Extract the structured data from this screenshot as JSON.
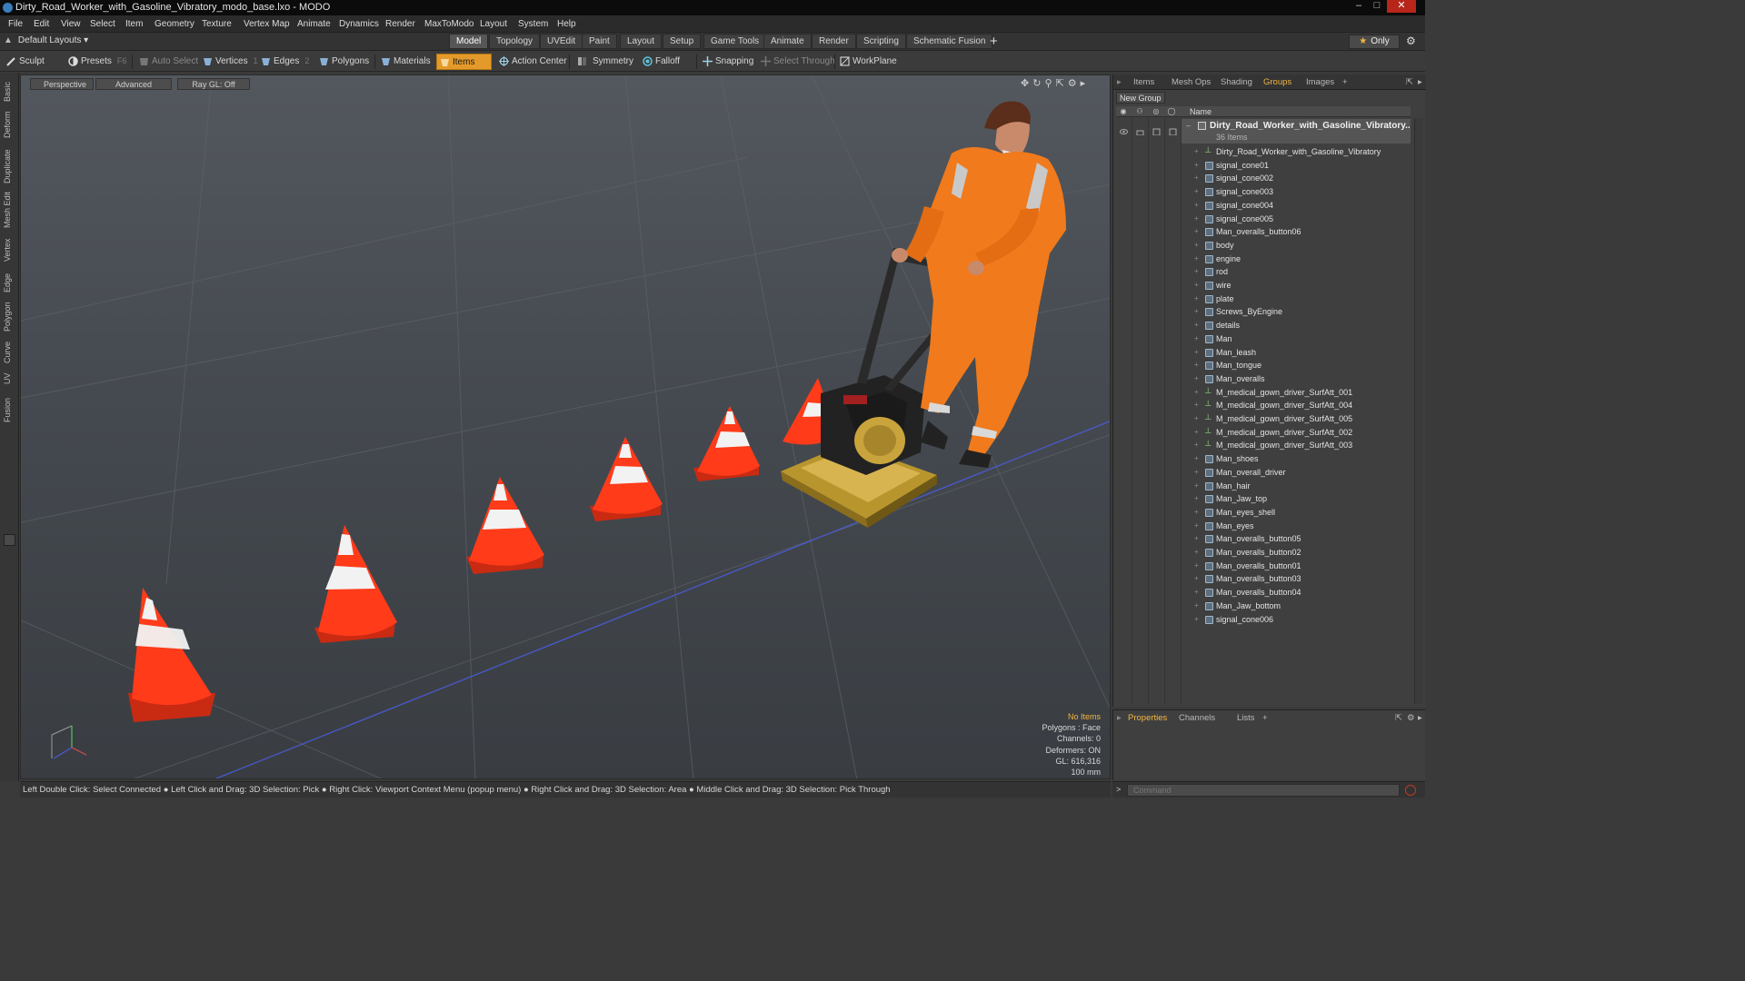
{
  "window": {
    "title": "Dirty_Road_Worker_with_Gasoline_Vibratory_modo_base.lxo - MODO",
    "minimize": "–",
    "maximize": "□",
    "close": "✕"
  },
  "menu": [
    "File",
    "Edit",
    "View",
    "Select",
    "Item",
    "Geometry",
    "Texture",
    "Vertex Map",
    "Animate",
    "Dynamics",
    "Render",
    "MaxToModo",
    "Layout",
    "System",
    "Help"
  ],
  "layout": {
    "selector": "Default Layouts ▾",
    "tabs": [
      "Model",
      "Topology",
      "UVEdit",
      "Paint",
      "Layout",
      "Setup",
      "Game Tools",
      "Animate",
      "Render",
      "Scripting",
      "Schematic Fusion"
    ],
    "active_tab": "Model",
    "add_tab": "+",
    "only_label": "Only"
  },
  "toolbar": {
    "sculpt": "Sculpt",
    "presets": "Presets",
    "presets_key": "F6",
    "auto_select": "Auto Select",
    "vertices": "Vertices",
    "vertices_count": "1",
    "edges": "Edges",
    "edges_count": "2",
    "polygons": "Polygons",
    "materials": "Materials",
    "items": "Items",
    "action_center": "Action Center",
    "symmetry": "Symmetry",
    "falloff": "Falloff",
    "snapping": "Snapping",
    "select_through": "Select Through",
    "workplane": "WorkPlane"
  },
  "left_tabs": [
    "Basic",
    "Deform",
    "Duplicate",
    "Mesh Edit",
    "Vertex",
    "Edge",
    "Polygon",
    "Curve",
    "UV",
    "Fusion"
  ],
  "viewport": {
    "view": "Perspective",
    "shading": "Advanced",
    "raygl": "Ray GL: Off",
    "info": {
      "selection": "No Items",
      "polygons": "Polygons : Face",
      "channels": "Channels: 0",
      "deformers": "Deformers: ON",
      "gl": "GL: 616,316",
      "scale": "100 mm"
    }
  },
  "status_bar": "Left Double Click: Select Connected ● Left Click and Drag: 3D Selection: Pick ● Right Click: Viewport Context Menu (popup menu) ● Right Click and Drag: 3D Selection: Area ● Middle Click and Drag: 3D Selection: Pick Through",
  "right_panel": {
    "tabs": [
      "Items",
      "Mesh Ops",
      "Shading",
      "Groups",
      "Images"
    ],
    "active_tab": "Groups",
    "add_tab": "+",
    "new_group": "New Group",
    "column_name": "Name",
    "group": {
      "name": "Dirty_Road_Worker_with_Gasoline_Vibratory...",
      "count": "36 Items"
    },
    "items": [
      {
        "label": "Dirty_Road_Worker_with_Gasoline_Vibratory",
        "kind": "locator"
      },
      {
        "label": "signal_cone01",
        "kind": "mesh"
      },
      {
        "label": "signal_cone002",
        "kind": "mesh"
      },
      {
        "label": "signal_cone003",
        "kind": "mesh"
      },
      {
        "label": "signal_cone004",
        "kind": "mesh"
      },
      {
        "label": "signal_cone005",
        "kind": "mesh"
      },
      {
        "label": "Man_overalls_button06",
        "kind": "mesh"
      },
      {
        "label": "body",
        "kind": "mesh"
      },
      {
        "label": "engine",
        "kind": "mesh"
      },
      {
        "label": "rod",
        "kind": "mesh"
      },
      {
        "label": "wire",
        "kind": "mesh"
      },
      {
        "label": "plate",
        "kind": "mesh"
      },
      {
        "label": "Screws_ByEngine",
        "kind": "mesh"
      },
      {
        "label": "details",
        "kind": "mesh"
      },
      {
        "label": "Man",
        "kind": "mesh"
      },
      {
        "label": "Man_leash",
        "kind": "mesh"
      },
      {
        "label": "Man_tongue",
        "kind": "mesh"
      },
      {
        "label": "Man_overalls",
        "kind": "mesh"
      },
      {
        "label": "M_medical_gown_driver_SurfAtt_001",
        "kind": "locator"
      },
      {
        "label": "M_medical_gown_driver_SurfAtt_004",
        "kind": "locator"
      },
      {
        "label": "M_medical_gown_driver_SurfAtt_005",
        "kind": "locator"
      },
      {
        "label": "M_medical_gown_driver_SurfAtt_002",
        "kind": "locator"
      },
      {
        "label": "M_medical_gown_driver_SurfAtt_003",
        "kind": "locator"
      },
      {
        "label": "Man_shoes",
        "kind": "mesh"
      },
      {
        "label": "Man_overall_driver",
        "kind": "mesh"
      },
      {
        "label": "Man_hair",
        "kind": "mesh"
      },
      {
        "label": "Man_Jaw_top",
        "kind": "mesh"
      },
      {
        "label": "Man_eyes_shell",
        "kind": "mesh"
      },
      {
        "label": "Man_eyes",
        "kind": "mesh"
      },
      {
        "label": "Man_overalls_button05",
        "kind": "mesh"
      },
      {
        "label": "Man_overalls_button02",
        "kind": "mesh"
      },
      {
        "label": "Man_overalls_button01",
        "kind": "mesh"
      },
      {
        "label": "Man_overalls_button03",
        "kind": "mesh"
      },
      {
        "label": "Man_overalls_button04",
        "kind": "mesh"
      },
      {
        "label": "Man_Jaw_bottom",
        "kind": "mesh"
      },
      {
        "label": "signal_cone006",
        "kind": "mesh"
      }
    ]
  },
  "properties_panel": {
    "tabs": [
      "Properties",
      "Channels",
      "Lists"
    ],
    "active_tab": "Properties",
    "add_tab": "+"
  },
  "command": {
    "placeholder": "Command"
  },
  "colors": {
    "accent": "#f2b640",
    "items_active": "#e49a2a",
    "cone": "#ff3b1a",
    "worker_suit": "#f07a1c",
    "axis_line": "#4a5bd6"
  }
}
